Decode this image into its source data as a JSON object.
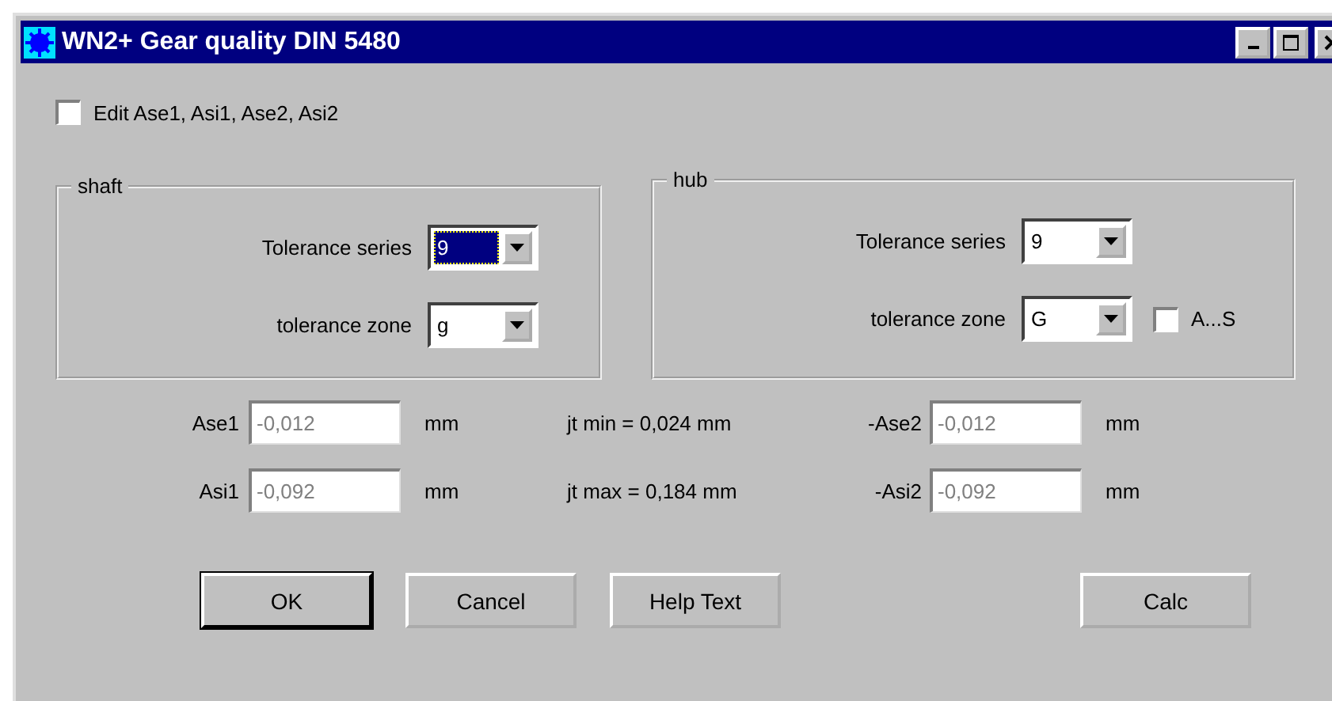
{
  "window": {
    "title": "WN2+ Gear quality DIN 5480"
  },
  "edit_checkbox": {
    "label": "Edit Ase1, Asi1, Ase2, Asi2",
    "checked": false
  },
  "groups": [
    {
      "title": "shaft",
      "rows": [
        {
          "label": "Tolerance series",
          "value": "9",
          "focused": true
        },
        {
          "label": "tolerance zone",
          "value": "g",
          "focused": false
        }
      ]
    },
    {
      "title": "hub",
      "rows": [
        {
          "label": "Tolerance series",
          "value": "9",
          "focused": false
        },
        {
          "label": "tolerance zone",
          "value": "G",
          "focused": false,
          "checkbox": {
            "label": "A...S",
            "checked": false
          }
        }
      ]
    }
  ],
  "fields": [
    {
      "label": "Ase1",
      "value": "-0,012",
      "unit": "mm",
      "disabled": true,
      "note": "jt min = 0,024 mm",
      "label2": "-Ase2",
      "value2": "-0,012",
      "unit2": "mm"
    },
    {
      "label": "Asi1",
      "value": "-0,092",
      "unit": "mm",
      "disabled": true,
      "note": "jt max = 0,184 mm",
      "label2": "-Asi2",
      "value2": "-0,092",
      "unit2": "mm"
    }
  ],
  "buttons": [
    {
      "label": "OK",
      "default": true
    },
    {
      "label": "Cancel",
      "default": false
    },
    {
      "label": "Help Text",
      "default": false
    },
    {
      "label": "Calc",
      "default": false
    }
  ]
}
